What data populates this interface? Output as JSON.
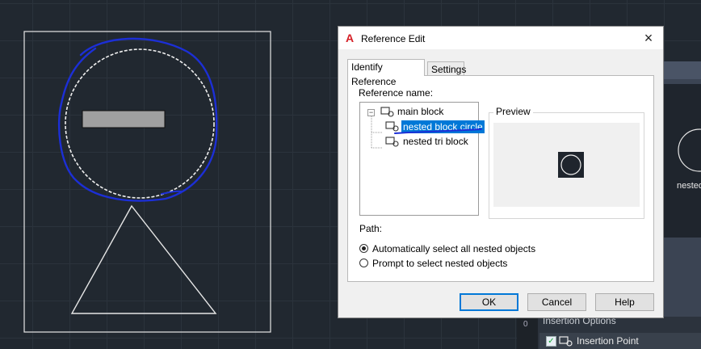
{
  "dialog": {
    "title": "Reference Edit",
    "close_glyph": "×",
    "tabs": [
      {
        "label": "Identify Reference",
        "selected": true
      },
      {
        "label": "Settings",
        "selected": false
      }
    ],
    "reference_name_label": "Reference name:",
    "tree": [
      {
        "label": "main block",
        "expanded": true,
        "selected": false
      },
      {
        "label": "nested block circle",
        "selected": true
      },
      {
        "label": "nested tri block",
        "selected": false
      }
    ],
    "tree_expander_glyph": "−",
    "preview_label": "Preview",
    "path_label": "Path:",
    "radio_options": [
      {
        "label": "Automatically select all nested objects",
        "checked": true
      },
      {
        "label": "Prompt to select nested objects",
        "checked": false
      }
    ],
    "buttons": {
      "ok": "OK",
      "cancel": "Cancel",
      "help": "Help"
    }
  },
  "palette": {
    "partial_label": "nested"
  },
  "insertion_options": {
    "title": "Insertion Options",
    "side_glyph": "0",
    "checkbox_glyph": "✓",
    "insertion_point_label": "Insertion Point",
    "checked": true
  },
  "colors": {
    "canvas_bg": "#212830",
    "annotation": "#1c2fd6",
    "selection": "#0078d7"
  }
}
